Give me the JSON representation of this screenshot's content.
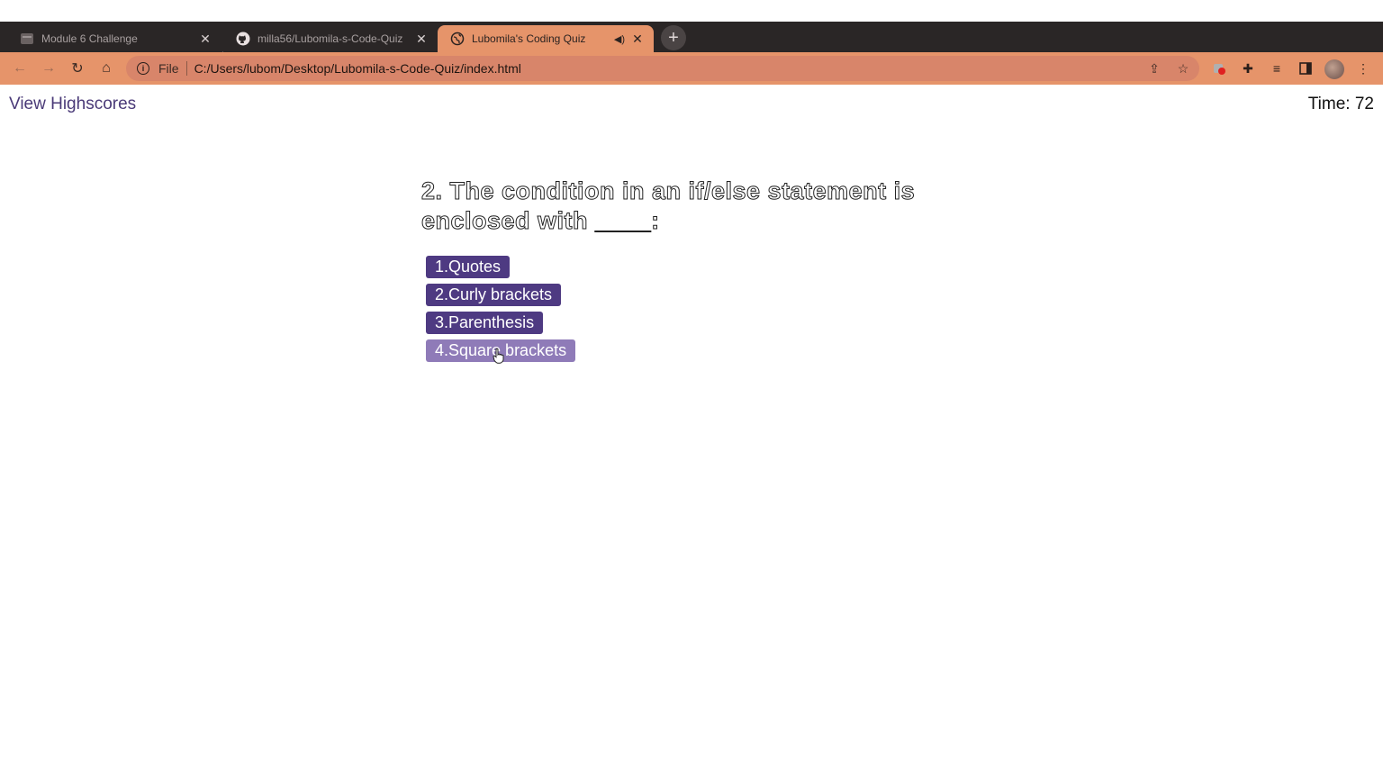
{
  "browser": {
    "tabs": [
      {
        "title": "Module 6 Challenge",
        "icon": "module-icon",
        "active": false
      },
      {
        "title": "milla56/Lubomila-s-Code-Quiz",
        "icon": "github-icon",
        "active": false
      },
      {
        "title": "Lubomila's Coding Quiz",
        "icon": "globe-icon",
        "active": true
      }
    ],
    "address": {
      "scheme": "File",
      "url": "C:/Users/lubom/Desktop/Lubomila-s-Code-Quiz/index.html"
    },
    "accent_color": "#e6946a"
  },
  "quiz": {
    "highscores_link": "View Highscores",
    "timer_text": "Time: 72",
    "question": "2. The condition in an if/else statement is enclosed with ____:",
    "answers": [
      "1.Quotes",
      "2.Curly brackets",
      "3.Parenthesis",
      "4.Square brackets"
    ],
    "button_color": "#4e3a82",
    "hover_color": "#8f7bb8"
  }
}
